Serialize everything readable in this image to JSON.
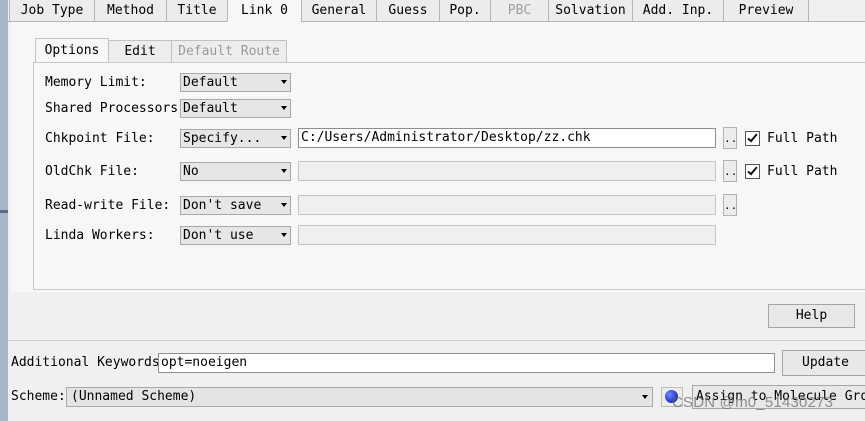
{
  "top_tabs": [
    {
      "label": "Job Type",
      "state": "normal"
    },
    {
      "label": "Method",
      "state": "normal"
    },
    {
      "label": "Title",
      "state": "normal"
    },
    {
      "label": "Link 0",
      "state": "active"
    },
    {
      "label": "General",
      "state": "normal"
    },
    {
      "label": "Guess",
      "state": "normal"
    },
    {
      "label": "Pop.",
      "state": "normal"
    },
    {
      "label": "PBC",
      "state": "disabled"
    },
    {
      "label": "Solvation",
      "state": "normal"
    },
    {
      "label": "Add. Inp.",
      "state": "normal"
    },
    {
      "label": "Preview",
      "state": "normal"
    }
  ],
  "sub_tabs": [
    {
      "label": "Options",
      "state": "active"
    },
    {
      "label": "Edit",
      "state": "normal"
    },
    {
      "label": "Default Route",
      "state": "disabled"
    }
  ],
  "rows": {
    "memory_limit": {
      "label": "Memory Limit:",
      "value": "Default"
    },
    "shared_processors": {
      "label": "Shared Processors:",
      "value": "Default"
    },
    "chkpoint_file": {
      "label": "Chkpoint File:",
      "value": "Specify...",
      "path": "C:/Users/Administrator/Desktop/zz.chk",
      "browse": "..",
      "full_path_label": "Full Path",
      "full_path_checked": true
    },
    "oldchk_file": {
      "label": "OldChk File:",
      "value": "No",
      "path": "",
      "browse": "..",
      "full_path_label": "Full Path",
      "full_path_checked": true
    },
    "readwrite_file": {
      "label": "Read-write File:",
      "value": "Don't save",
      "path": "",
      "browse": ".."
    },
    "linda_workers": {
      "label": "Linda Workers:",
      "value": "Don't use",
      "path": ""
    }
  },
  "buttons": {
    "help": "Help",
    "update": "Update",
    "assign": "Assign to Molecule Group"
  },
  "additional_keywords": {
    "label": "Additional Keywords:",
    "value": "opt=noeigen"
  },
  "scheme": {
    "label": "Scheme:",
    "value": "(Unnamed Scheme)"
  },
  "watermark": "CSDN @m0_51430273"
}
